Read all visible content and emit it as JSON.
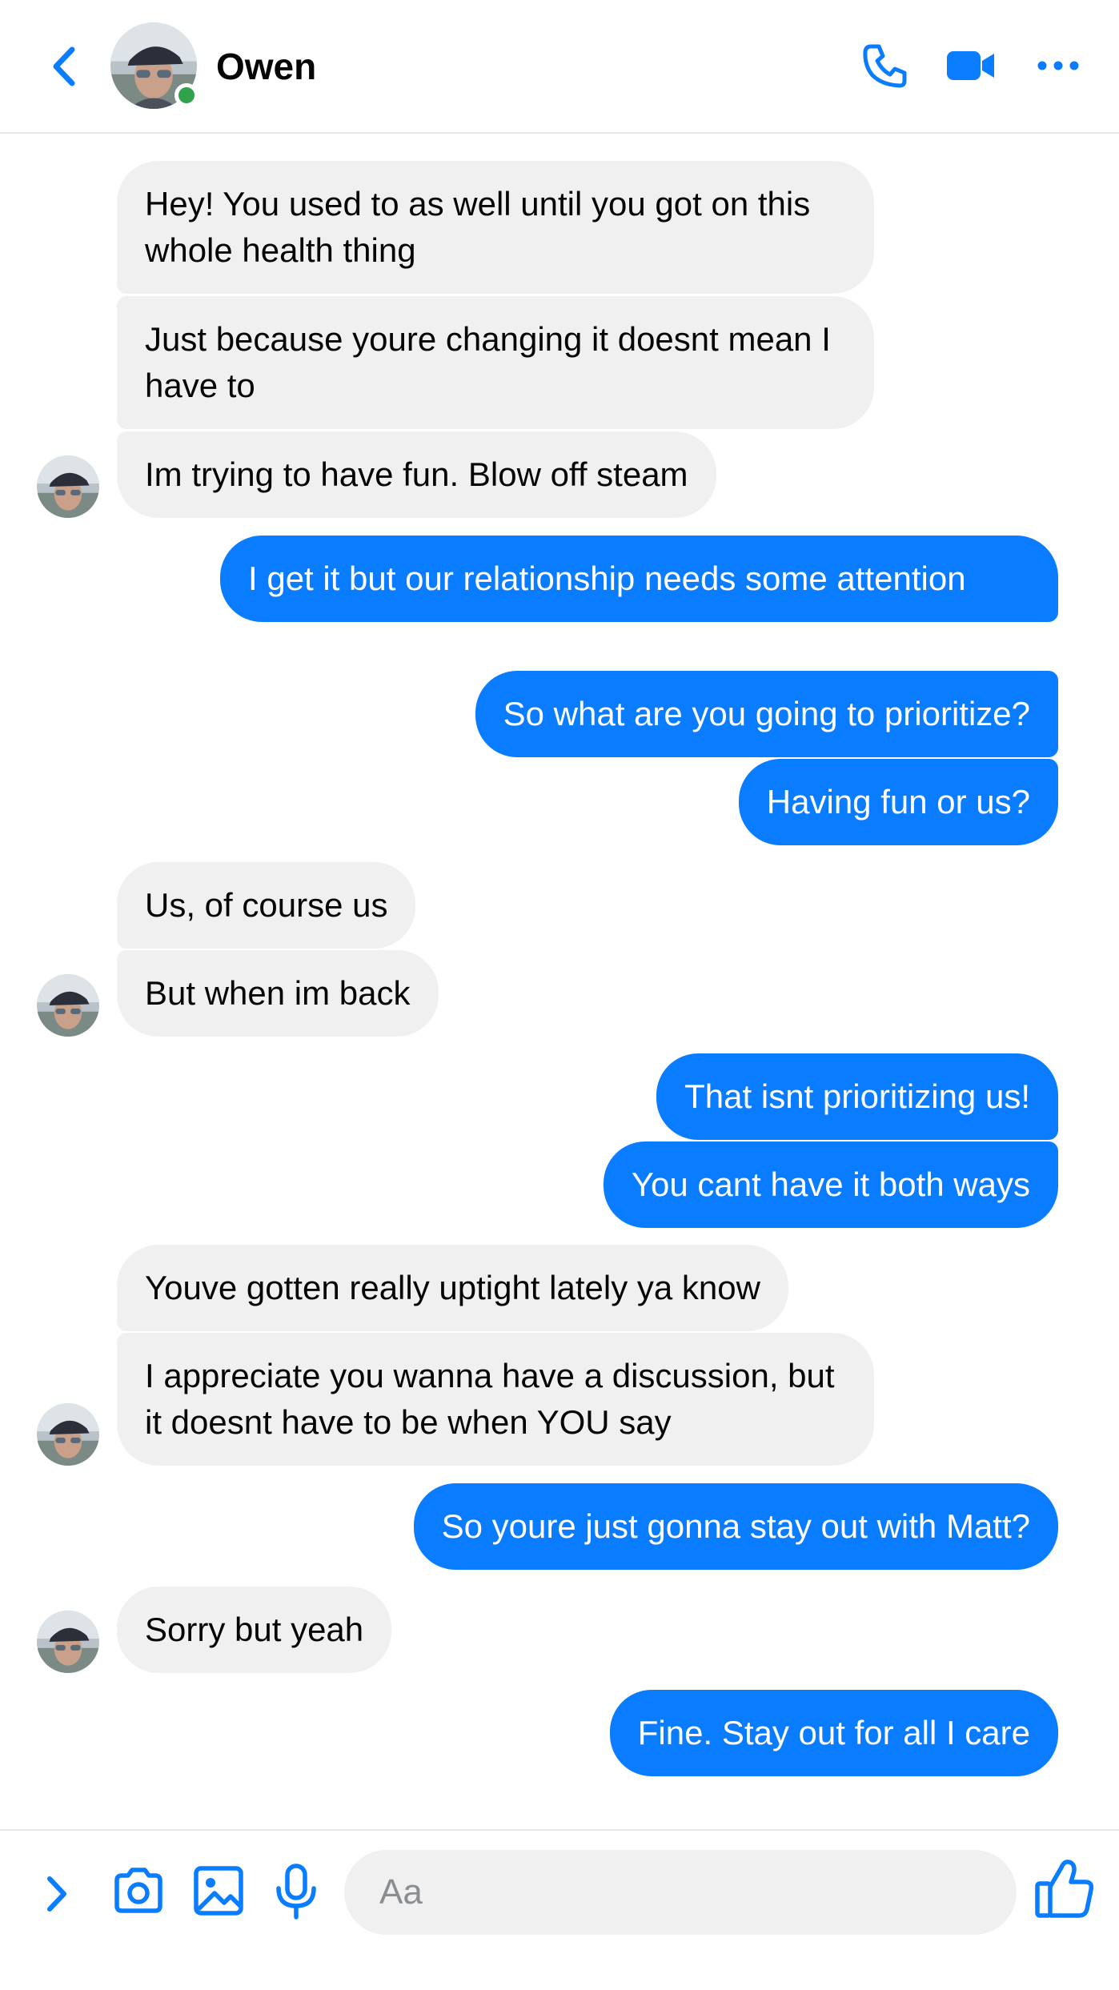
{
  "header": {
    "contact_name": "Owen",
    "online": true
  },
  "colors": {
    "accent": "#0a7cff",
    "incoming_bubble": "#f0f0f0",
    "online_dot": "#31a24c"
  },
  "icons": {
    "back": "chevron-left-icon",
    "call": "phone-icon",
    "video": "video-camera-icon",
    "more": "more-horizontal-icon",
    "expand": "chevron-right-icon",
    "camera": "camera-icon",
    "gallery": "image-icon",
    "voice": "microphone-icon",
    "like": "thumbs-up-icon"
  },
  "messages": [
    {
      "sender": "Owen",
      "text": "Hey! You used to as well until you got on this whole health thing"
    },
    {
      "sender": "Owen",
      "text": "Just because youre changing it doesnt mean I have to"
    },
    {
      "sender": "Owen",
      "text": "Im trying to have fun. Blow off steam"
    },
    {
      "sender": "me",
      "text": "I get it but our relationship needs some attention"
    },
    {
      "sender": "me",
      "text": "So what are you going to prioritize?"
    },
    {
      "sender": "me",
      "text": "Having fun or us?"
    },
    {
      "sender": "Owen",
      "text": "Us, of course us"
    },
    {
      "sender": "Owen",
      "text": "But when im back"
    },
    {
      "sender": "me",
      "text": "That isnt prioritizing us!"
    },
    {
      "sender": "me",
      "text": "You cant have it both ways"
    },
    {
      "sender": "Owen",
      "text": "Youve gotten really uptight lately ya know"
    },
    {
      "sender": "Owen",
      "text": "I appreciate you wanna have a discussion, but it doesnt have to be when YOU say"
    },
    {
      "sender": "me",
      "text": "So youre just gonna stay out with Matt?"
    },
    {
      "sender": "Owen",
      "text": "Sorry but yeah"
    },
    {
      "sender": "me",
      "text": "Fine. Stay out for all I care"
    }
  ],
  "composer": {
    "placeholder": "Aa",
    "value": ""
  }
}
